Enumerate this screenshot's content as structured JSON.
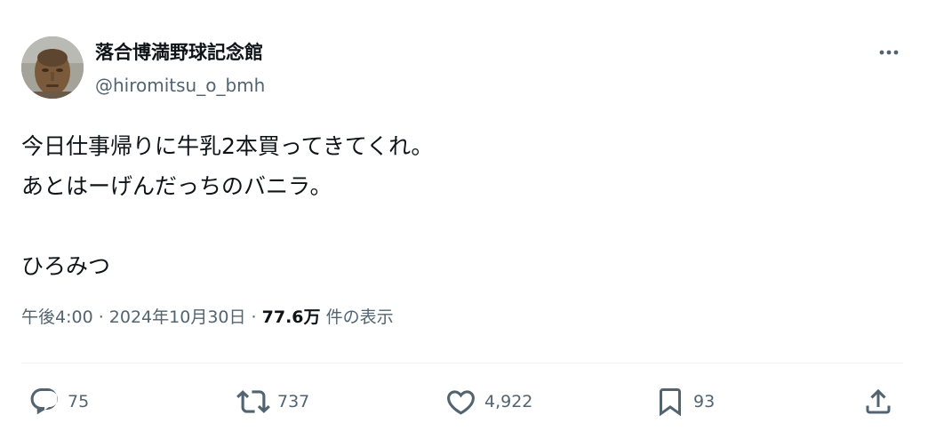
{
  "author": {
    "display_name": "落合博満野球記念館",
    "handle": "@hiromitsu_o_bmh"
  },
  "tweet": {
    "lines": [
      "今日仕事帰りに牛乳2本買ってきてくれ。",
      "あとはーげんだっちのバニラ。",
      "",
      "ひろみつ"
    ]
  },
  "meta": {
    "time": "午後4:00",
    "separator": " · ",
    "date": "2024年10月30日",
    "views_count": "77.6万",
    "views_label": "件の表示"
  },
  "actions": {
    "reply_count": "75",
    "repost_count": "737",
    "like_count": "4,922",
    "bookmark_count": "93"
  },
  "icons": {
    "more": "more-horizontal-icon",
    "reply": "reply-icon",
    "repost": "repost-icon",
    "like": "heart-icon",
    "bookmark": "bookmark-icon",
    "share": "share-icon"
  },
  "colors": {
    "text": "#0f1419",
    "secondary_text": "#536471",
    "divider": "#eff3f4"
  }
}
